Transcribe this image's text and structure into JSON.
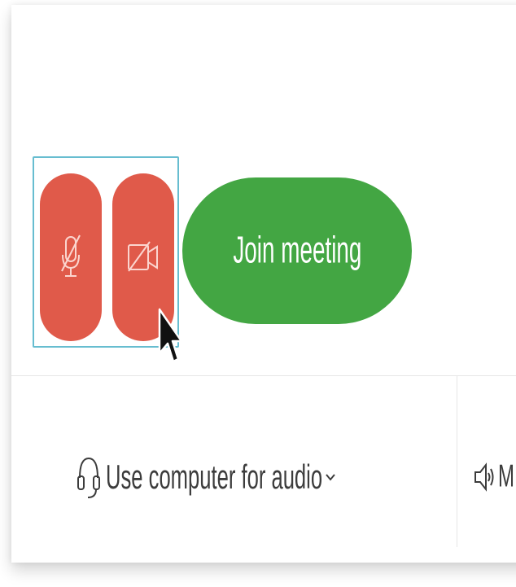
{
  "preview_controls": {
    "mic_button": {
      "icon": "mic-off-icon",
      "state": "muted"
    },
    "camera_button": {
      "icon": "video-off-icon",
      "state": "off"
    },
    "join_label": "Join meeting"
  },
  "audio_options": {
    "computer_audio_label": "Use computer for audio",
    "computer_audio_icon": "headset-icon",
    "dropdown_icon": "chevron-down-icon",
    "speaker_label": "M",
    "speaker_icon": "speaker-icon"
  },
  "colors": {
    "muted_red": "#e05a4a",
    "join_green": "#43a643",
    "focus_outline": "#67bdd0",
    "text": "#3c3c3c"
  }
}
